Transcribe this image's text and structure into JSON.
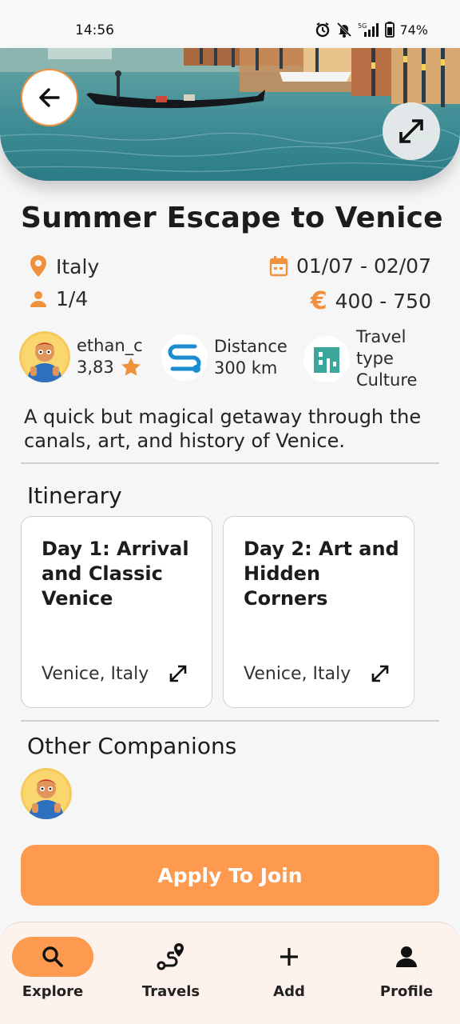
{
  "status_bar": {
    "time": "14:56",
    "battery": "74%",
    "network": "5G"
  },
  "trip": {
    "title": "Summer Escape to Venice",
    "country": "Italy",
    "dates": "01/07 - 02/07",
    "participants": "1/4",
    "budget": "400 - 750",
    "currency_symbol": "€",
    "description": "A quick but magical getaway through the canals, art, and history of Venice."
  },
  "creator": {
    "username": "ethan_c",
    "rating": "3,83"
  },
  "distance": {
    "label": "Distance",
    "value": "300 km"
  },
  "travel_type": {
    "label_line1": "Travel",
    "label_line2": "type",
    "value": "Culture"
  },
  "itinerary": {
    "title": "Itinerary",
    "days": [
      {
        "title": "Day 1: Arrival and Classic Venice",
        "location": "Venice, Italy"
      },
      {
        "title": "Day 2: Art and Hidden Corners",
        "location": "Venice, Italy"
      }
    ]
  },
  "companions": {
    "title": "Other Companions"
  },
  "apply_button": "Apply To Join",
  "bottom_nav": [
    {
      "label": "Explore",
      "icon": "search-icon",
      "active": true
    },
    {
      "label": "Travels",
      "icon": "route-icon",
      "active": false
    },
    {
      "label": "Add",
      "icon": "plus-icon",
      "active": false
    },
    {
      "label": "Profile",
      "icon": "person-icon",
      "active": false
    }
  ],
  "colors": {
    "accent": "#fe9a4f",
    "icon_orange": "#f0913e",
    "teal": "#3aa79a",
    "blue": "#1a8ccf"
  }
}
